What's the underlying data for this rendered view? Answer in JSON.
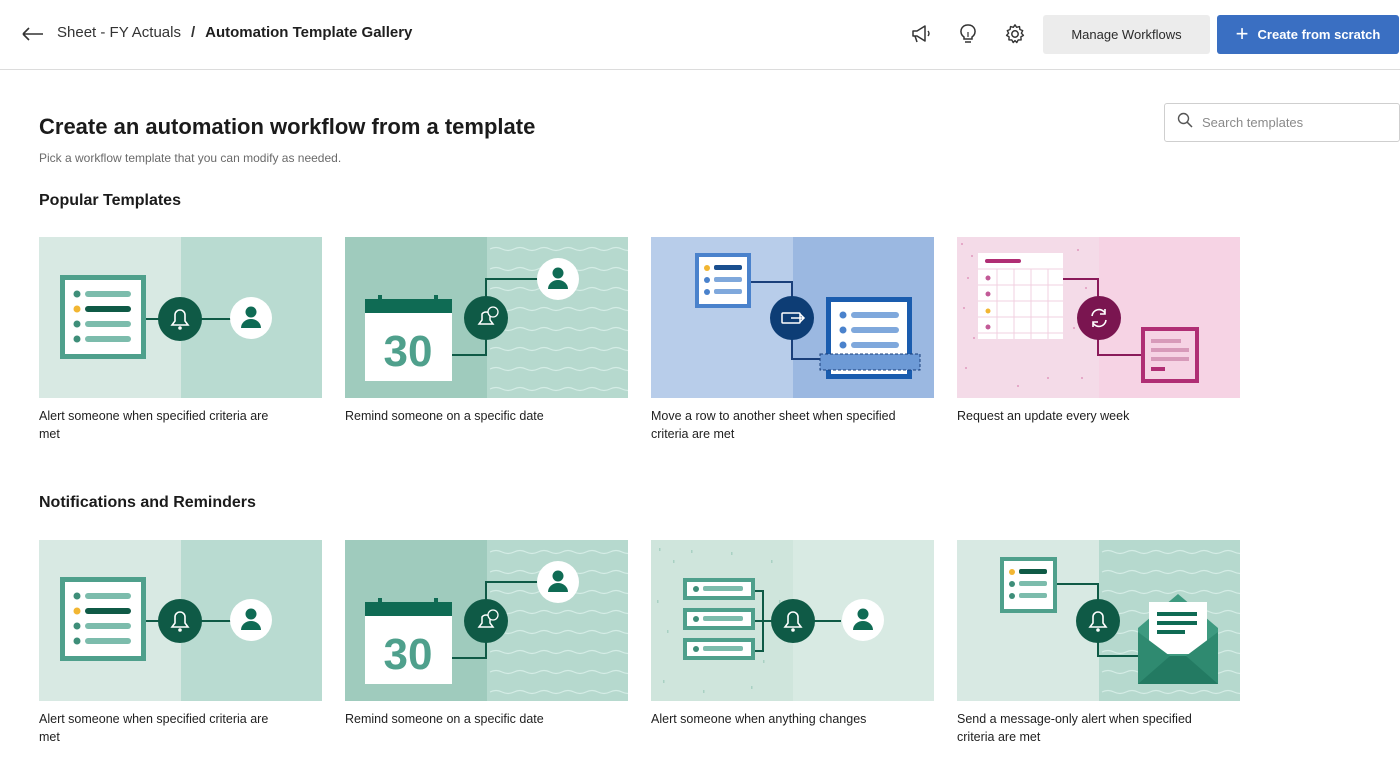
{
  "header": {
    "breadcrumb_parent": "Sheet - FY Actuals",
    "breadcrumb_separator": "/",
    "breadcrumb_current": "Automation Template Gallery",
    "manage_label": "Manage Workflows",
    "create_label": "Create from scratch",
    "icons": [
      "back-arrow-icon",
      "megaphone-icon",
      "lightbulb-icon",
      "gear-icon",
      "plus-icon"
    ]
  },
  "page": {
    "title": "Create an automation workflow from a template",
    "subtitle": "Pick a workflow template that you can modify as needed.",
    "search_placeholder": "Search templates"
  },
  "sections": [
    {
      "title": "Popular Templates",
      "cards": [
        {
          "label": "Alert someone when specified criteria are met"
        },
        {
          "label": "Remind someone on a specific date"
        },
        {
          "label": "Move a row to another sheet when specified criteria are met"
        },
        {
          "label": "Request an update every week"
        }
      ]
    },
    {
      "title": "Notifications and Reminders",
      "cards": [
        {
          "label": "Alert someone when specified criteria are met"
        },
        {
          "label": "Remind someone on a specific date"
        },
        {
          "label": "Alert someone when anything changes"
        },
        {
          "label": "Send a message-only alert when specified criteria are met"
        }
      ]
    }
  ],
  "illustration": {
    "calendar_day": "30"
  },
  "colors": {
    "primary": "#3a6fc2",
    "teal_dark": "#0f5a46",
    "teal_mid": "#4fa08c",
    "blue_dark": "#1a4f8f",
    "magenta": "#8a1a5a"
  }
}
